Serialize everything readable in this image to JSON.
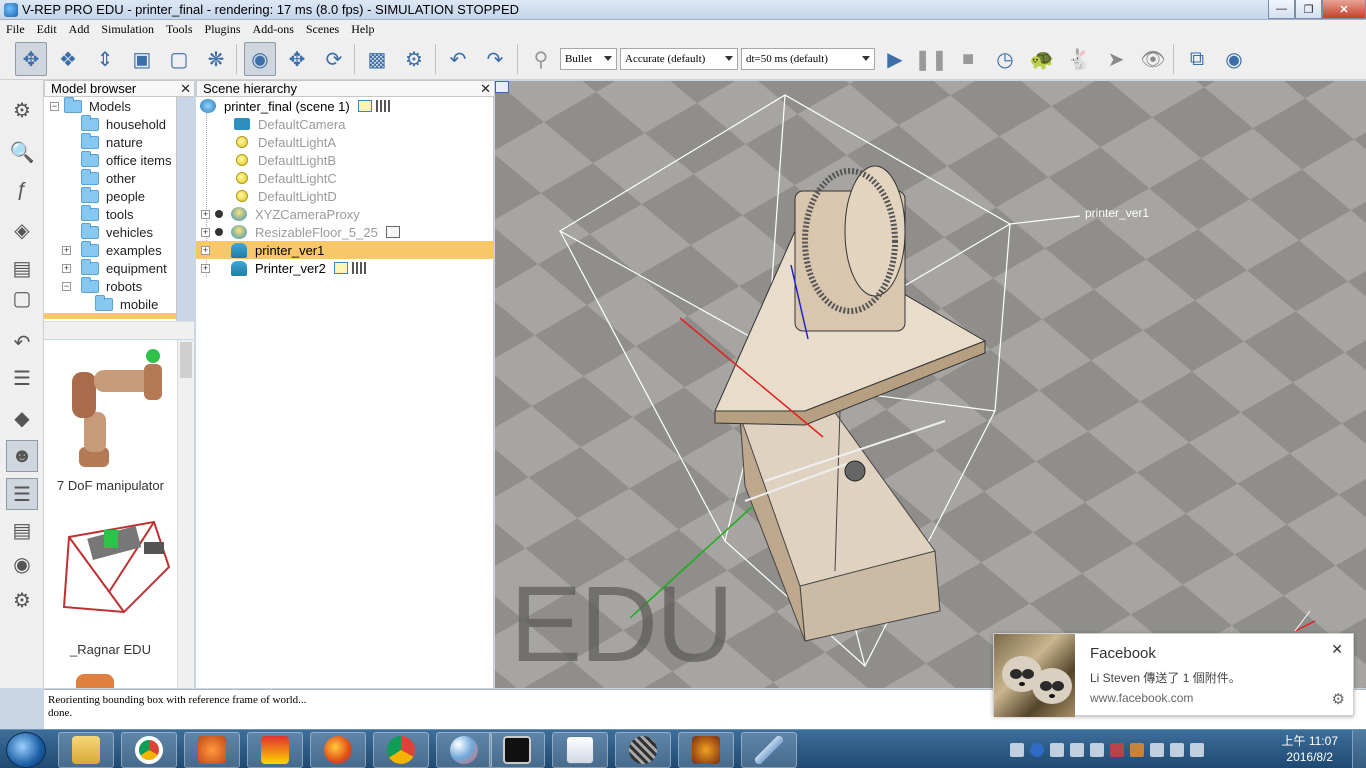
{
  "window": {
    "title": "V-REP PRO EDU - printer_final - rendering: 17 ms (8.0 fps) - SIMULATION STOPPED"
  },
  "menu": [
    "File",
    "Edit",
    "Add",
    "Simulation",
    "Tools",
    "Plugins",
    "Add-ons",
    "Scenes",
    "Help"
  ],
  "toolbar": {
    "engine": "Bullet",
    "accuracy": "Accurate (default)",
    "timestep": "dt=50 ms (default)"
  },
  "model_browser": {
    "header": "Model browser",
    "close": "✕",
    "root": "Models",
    "folders": [
      "household",
      "nature",
      "office items",
      "other",
      "people",
      "tools",
      "vehicles",
      "examples",
      "equipment",
      "robots",
      "mobile"
    ],
    "thumbnails": [
      "7 DoF manipulator",
      "_Ragnar EDU"
    ]
  },
  "scene_hierarchy": {
    "header": "Scene hierarchy",
    "close": "✕",
    "scene_name": "printer_final (scene 1)",
    "objects": [
      "DefaultCamera",
      "DefaultLightA",
      "DefaultLightB",
      "DefaultLightC",
      "DefaultLightD",
      "XYZCameraProxy",
      "ResizableFloor_5_25",
      "printer_ver1",
      "Printer_ver2"
    ]
  },
  "view3d": {
    "object_label": "printer_ver1",
    "watermark": "EDU",
    "floor_color": "#8a8987",
    "axis_colors": {
      "x": "#e02020",
      "y": "#18b018",
      "z": "#2020d0"
    }
  },
  "console": {
    "lines": [
      "Reorienting bounding box with reference frame of world...",
      "done."
    ]
  },
  "notification": {
    "app": "Facebook",
    "message": "Li Steven 傳送了 1 個附件。",
    "url": "www.facebook.com"
  },
  "taskbar": {
    "time": "上午 11:07",
    "date": "2016/8/2"
  }
}
